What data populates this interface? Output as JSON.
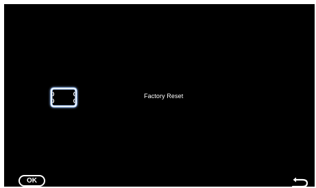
{
  "menu": {
    "selected_option": {
      "label": "Factory Reset",
      "icon": "factory-reset-frame-icon"
    }
  },
  "footer": {
    "ok_label": "OK",
    "back_icon": "back-arrow-icon"
  },
  "colors": {
    "background": "#000000",
    "text": "#ffffff",
    "icon_glow": "#9fc6ff"
  }
}
